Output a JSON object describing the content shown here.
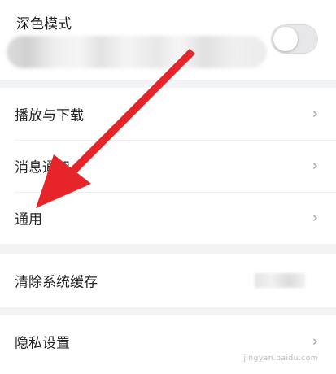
{
  "dark_mode": {
    "label": "深色模式",
    "enabled": false
  },
  "settings": [
    {
      "label": "播放与下载"
    },
    {
      "label": "消息通知"
    },
    {
      "label": "通用"
    }
  ],
  "clear_cache": {
    "label": "清除系统缓存"
  },
  "privacy": {
    "label": "隐私设置"
  },
  "watermark": {
    "text": "jingyan.baidu.com"
  },
  "colors": {
    "arrow": "#e8242b",
    "background": "#f2f3f5",
    "card": "#ffffff"
  },
  "icons": {
    "chevron": "chevron-right-icon",
    "arrow": "red-annotation-arrow"
  }
}
